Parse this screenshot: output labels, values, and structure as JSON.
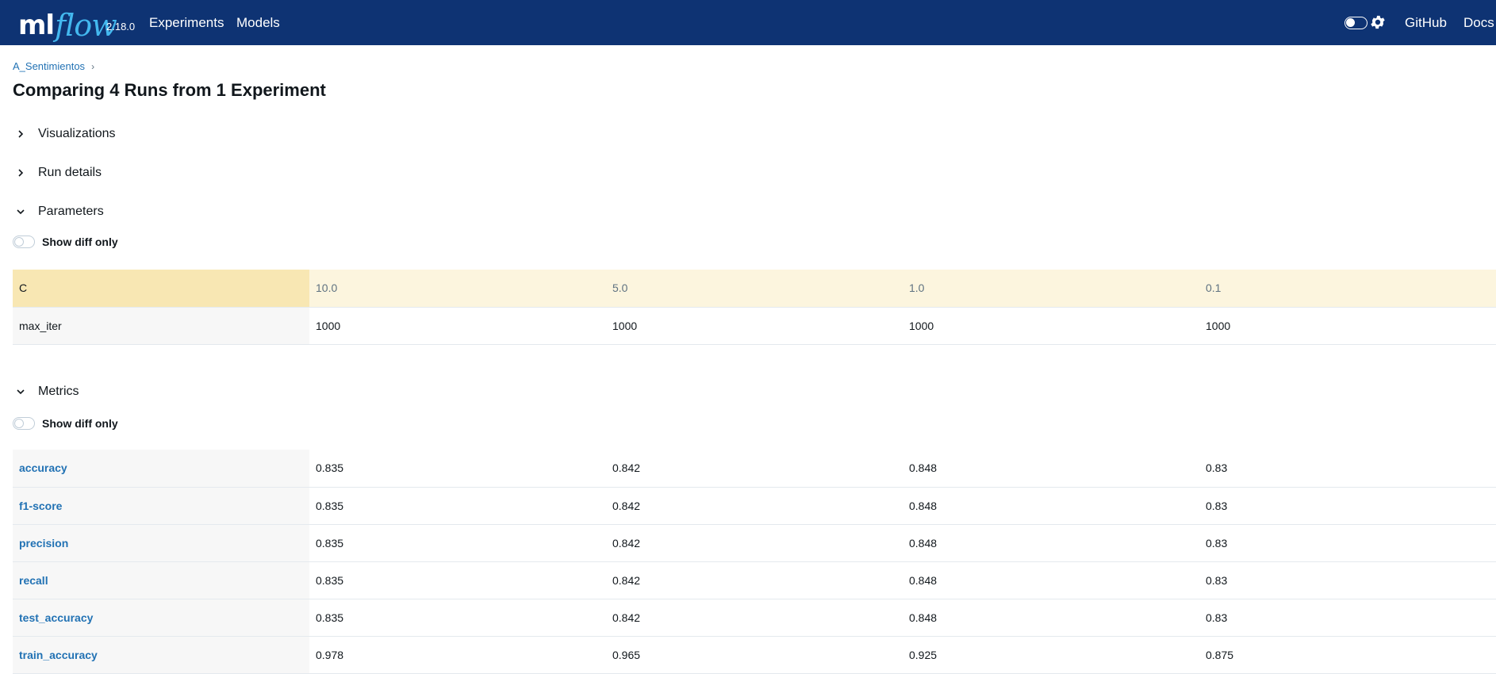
{
  "header": {
    "logo_ml": "ml",
    "logo_flow": "flow",
    "version": "2.18.0",
    "nav": [
      "Experiments",
      "Models"
    ],
    "right_links": [
      "GitHub",
      "Docs"
    ],
    "icons": [
      "theme-toggle",
      "gear-icon"
    ]
  },
  "breadcrumb": {
    "experiment": "A_Sentimientos",
    "separator": "›"
  },
  "page_title": "Comparing 4 Runs from 1 Experiment",
  "sections": {
    "visualizations": "Visualizations",
    "run_details": "Run details",
    "parameters": "Parameters",
    "metrics": "Metrics"
  },
  "show_diff_only": "Show diff only",
  "parameters": [
    {
      "key": "C",
      "values": [
        "10.0",
        "5.0",
        "1.0",
        "0.1"
      ],
      "highlighted": true
    },
    {
      "key": "max_iter",
      "values": [
        "1000",
        "1000",
        "1000",
        "1000"
      ],
      "highlighted": false
    }
  ],
  "metrics": [
    {
      "key": "accuracy",
      "values": [
        "0.835",
        "0.842",
        "0.848",
        "0.83"
      ]
    },
    {
      "key": "f1-score",
      "values": [
        "0.835",
        "0.842",
        "0.848",
        "0.83"
      ]
    },
    {
      "key": "precision",
      "values": [
        "0.835",
        "0.842",
        "0.848",
        "0.83"
      ]
    },
    {
      "key": "recall",
      "values": [
        "0.835",
        "0.842",
        "0.848",
        "0.83"
      ]
    },
    {
      "key": "test_accuracy",
      "values": [
        "0.835",
        "0.842",
        "0.848",
        "0.83"
      ]
    },
    {
      "key": "train_accuracy",
      "values": [
        "0.978",
        "0.965",
        "0.925",
        "0.875"
      ]
    }
  ],
  "colors": {
    "header_bg": "#0e3373",
    "logo_flow": "#43b8ef",
    "link": "#2272b4",
    "diff_key_bg": "#f8e7b3",
    "diff_value_bg": "#fcf5de"
  }
}
